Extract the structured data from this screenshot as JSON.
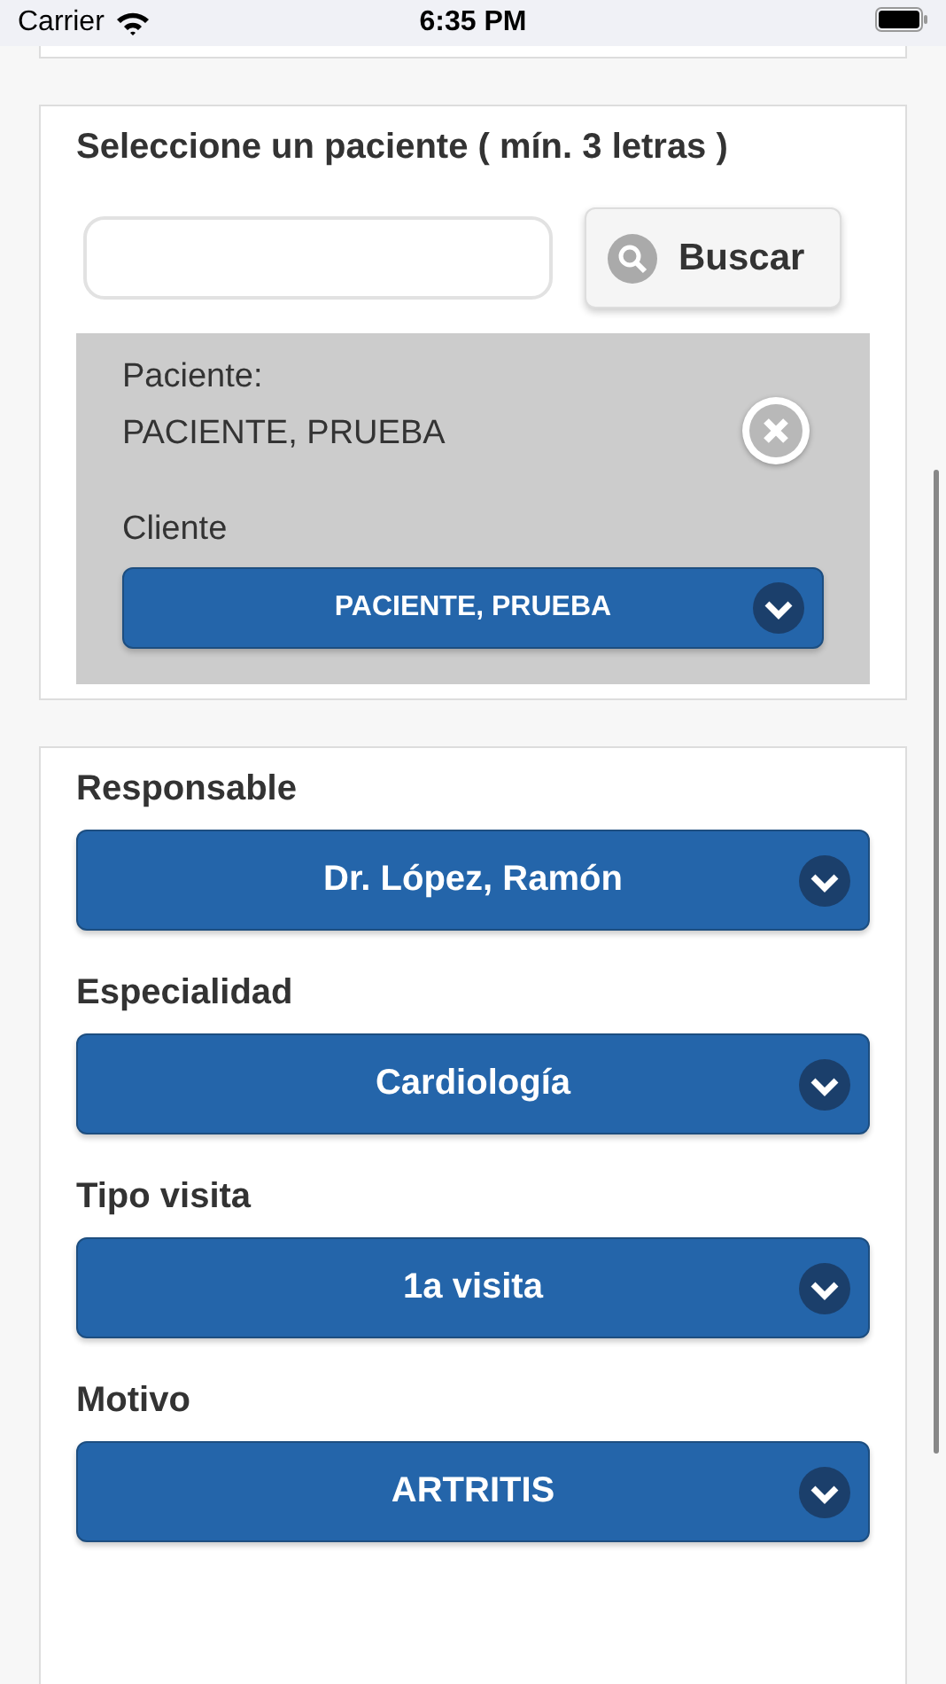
{
  "status_bar": {
    "carrier": "Carrier",
    "time": "6:35 PM"
  },
  "patient_search": {
    "title": "Seleccione un paciente ( mín. 3 letras )",
    "button": "Buscar",
    "selected_patient": {
      "label": "Paciente:",
      "name": "PACIENTE, PRUEBA",
      "client_label": "Cliente",
      "client_value": "PACIENTE, PRUEBA"
    }
  },
  "fields": [
    {
      "label": "Responsable",
      "value": "Dr. López, Ramón"
    },
    {
      "label": "Especialidad",
      "value": "Cardiología"
    },
    {
      "label": "Tipo visita",
      "value": "1a visita"
    },
    {
      "label": "Motivo",
      "value": "ARTRITIS"
    }
  ]
}
